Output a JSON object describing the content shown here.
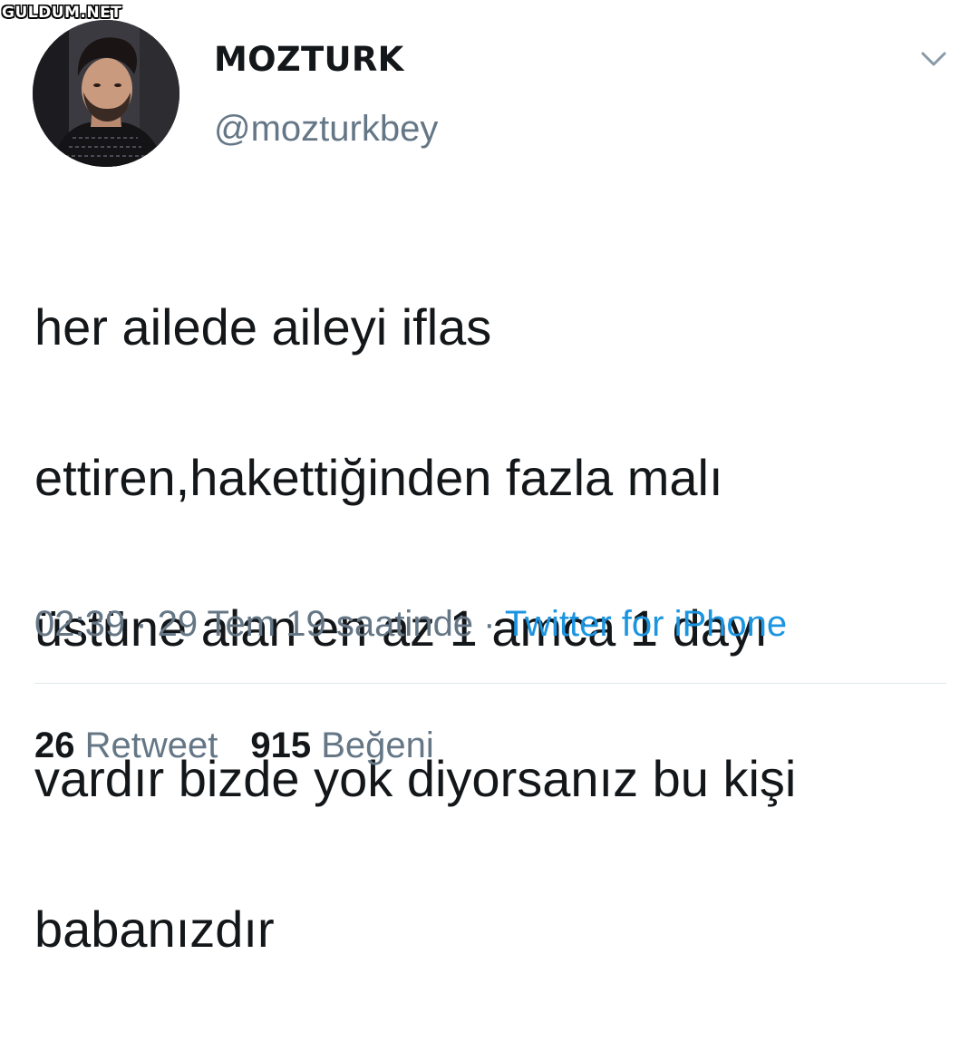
{
  "watermark": {
    "text": "GULDUM.NET"
  },
  "user": {
    "display_name": "MOZTURK",
    "handle": "@mozturkbey"
  },
  "icons": {
    "menu": "chevron-down-icon",
    "avatar": "profile-photo"
  },
  "tweet": {
    "lines": [
      "her ailede aileyi iflas",
      "ettiren,hakettiğinden fazla malı",
      "üstüne alan en az 1 amca 1 dayı",
      "vardır bizde yok diyorsanız bu kişi",
      "babanızdır"
    ]
  },
  "meta": {
    "time": "02:39",
    "separator": " · ",
    "date": "29 Tem 19 saatinde",
    "source": "Twitter for iPhone"
  },
  "stats": {
    "retweets": {
      "count": "26",
      "label": "Retweet"
    },
    "likes": {
      "count": "915",
      "label": "Beğeni"
    }
  },
  "colors": {
    "text": "#14171a",
    "secondary": "#657786",
    "link": "#1b95e0",
    "divider": "#e1e8ed"
  }
}
